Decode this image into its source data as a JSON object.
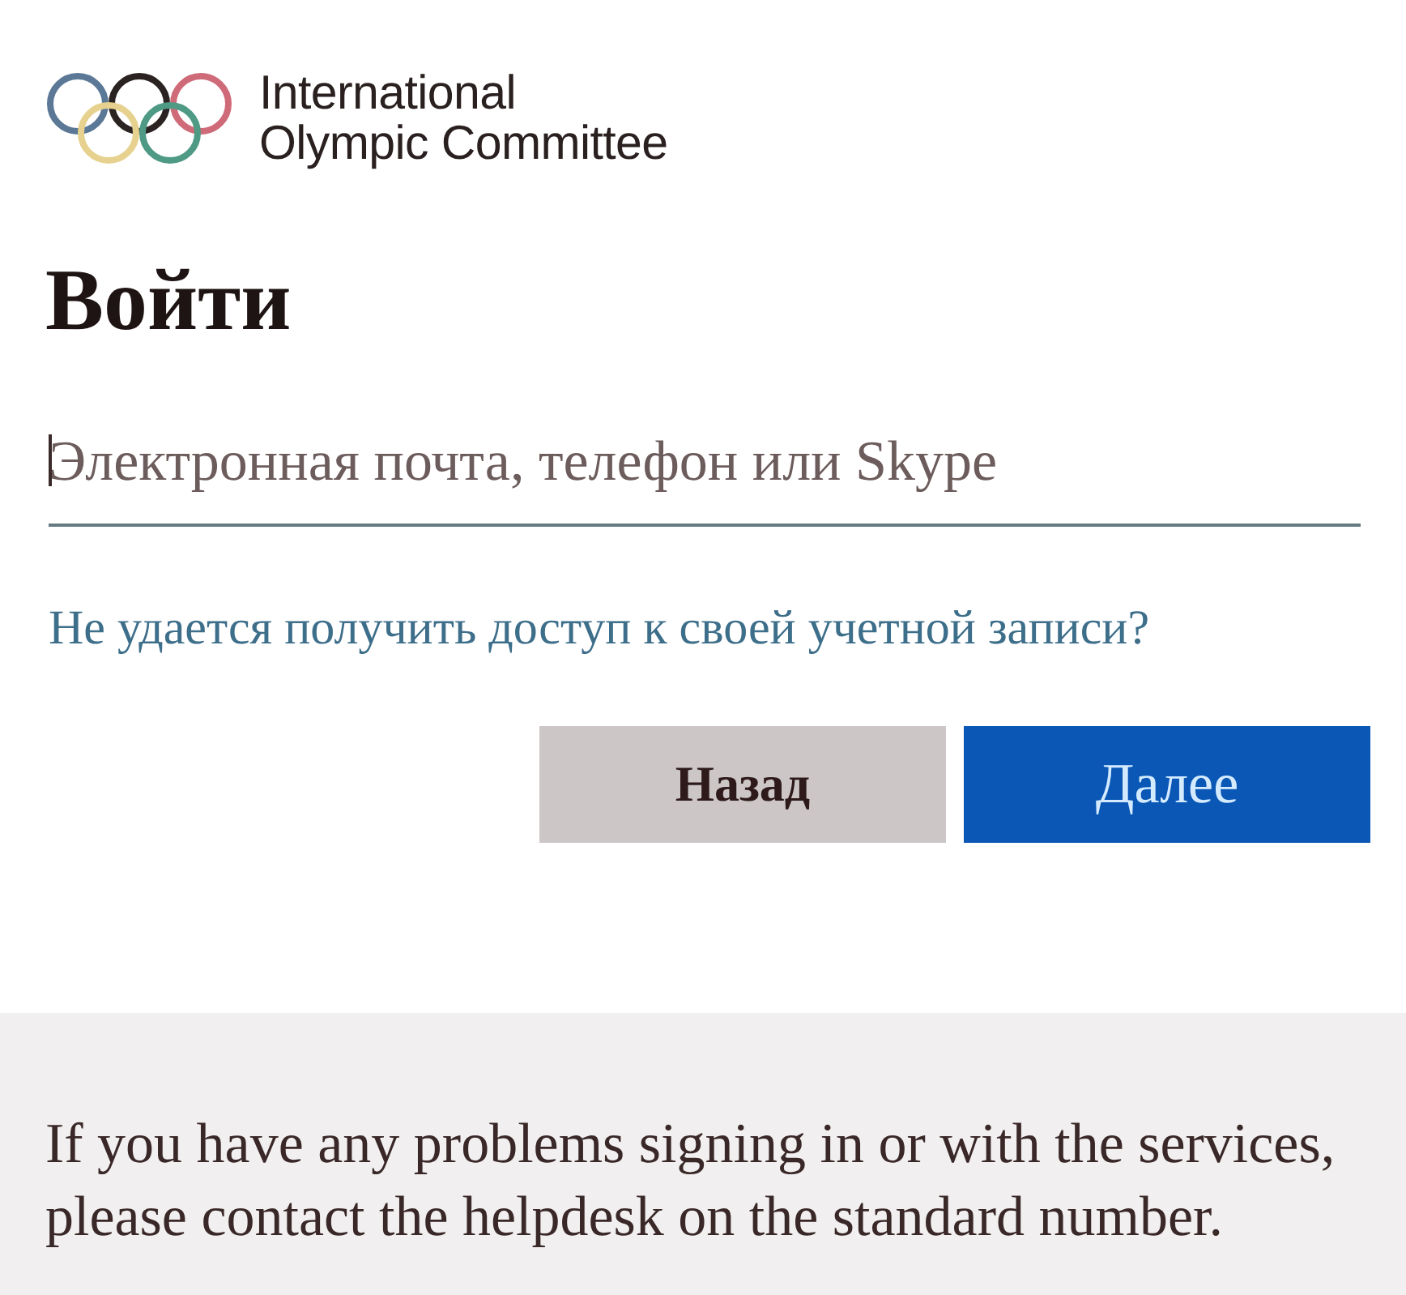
{
  "logo": {
    "lines": [
      "International",
      "Olympic Committee"
    ]
  },
  "heading": "Войти",
  "email_field": {
    "placeholder": "Электронная почта, телефон или Skype",
    "focused": true
  },
  "help_link": "Не удается получить доступ к своей учетной записи?",
  "buttons": [
    {
      "label": "Назад",
      "kind": "secondary"
    },
    {
      "label": "Далее",
      "kind": "primary"
    }
  ],
  "footer": {
    "text": "If you have any problems signing in or with the services, please contact the helpdesk on the standard number."
  }
}
